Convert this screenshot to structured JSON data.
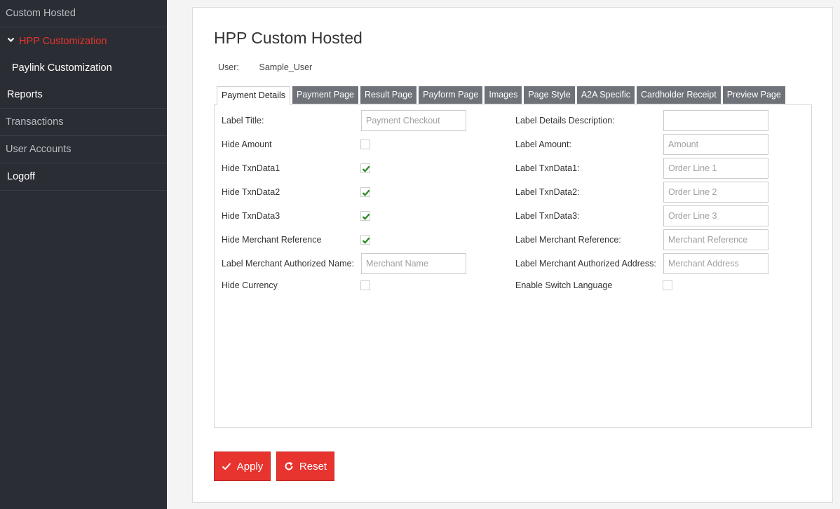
{
  "sidebar": {
    "items": [
      {
        "label": "Custom Hosted"
      },
      {
        "label": "HPP Customization"
      },
      {
        "label": "Paylink Customization"
      },
      {
        "label": "Reports"
      },
      {
        "label": "Transactions"
      },
      {
        "label": "User Accounts"
      },
      {
        "label": "Logoff"
      }
    ],
    "accent_color": "#e8342f"
  },
  "page": {
    "title": "HPP Custom Hosted",
    "user_label": "User:",
    "user_value": "Sample_User"
  },
  "tabs": [
    {
      "label": "Payment Details",
      "active": true
    },
    {
      "label": "Payment Page"
    },
    {
      "label": "Result Page"
    },
    {
      "label": "Payform Page"
    },
    {
      "label": "Images"
    },
    {
      "label": "Page Style"
    },
    {
      "label": "A2A Specific"
    },
    {
      "label": "Cardholder Receipt"
    },
    {
      "label": "Preview Page"
    }
  ],
  "form": {
    "left": [
      {
        "label": "Label Title:",
        "type": "input",
        "placeholder": "Payment Checkout",
        "value": ""
      },
      {
        "label": "Hide Amount",
        "type": "checkbox",
        "checked": false
      },
      {
        "label": "Hide TxnData1",
        "type": "checkbox",
        "checked": true
      },
      {
        "label": "Hide TxnData2",
        "type": "checkbox",
        "checked": true
      },
      {
        "label": "Hide TxnData3",
        "type": "checkbox",
        "checked": true
      },
      {
        "label": "Hide Merchant Reference",
        "type": "checkbox",
        "checked": true
      },
      {
        "label": "Label Merchant Authorized Name:",
        "type": "input",
        "placeholder": "Merchant Name",
        "value": ""
      },
      {
        "label": "Hide Currency",
        "type": "checkbox",
        "checked": false
      }
    ],
    "right": [
      {
        "label": "Label Details Description:",
        "type": "input",
        "placeholder": "",
        "value": ""
      },
      {
        "label": "Label Amount:",
        "type": "input",
        "placeholder": "Amount",
        "value": ""
      },
      {
        "label": "Label TxnData1:",
        "type": "input",
        "placeholder": "Order Line 1",
        "value": ""
      },
      {
        "label": "Label TxnData2:",
        "type": "input",
        "placeholder": "Order Line 2",
        "value": ""
      },
      {
        "label": "Label TxnData3:",
        "type": "input",
        "placeholder": "Order Line 3",
        "value": ""
      },
      {
        "label": "Label Merchant Reference:",
        "type": "input",
        "placeholder": "Merchant Reference",
        "value": ""
      },
      {
        "label": "Label Merchant Authorized Address:",
        "type": "input",
        "placeholder": "Merchant Address",
        "value": ""
      },
      {
        "label": "Enable Switch Language",
        "type": "checkbox",
        "checked": false
      }
    ]
  },
  "buttons": {
    "apply_label": "Apply",
    "reset_label": "Reset",
    "apply_icon": "check-icon",
    "reset_icon": "refresh-icon"
  }
}
